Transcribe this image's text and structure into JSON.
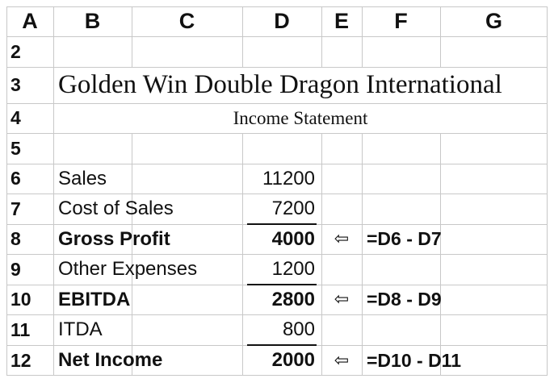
{
  "columns": [
    "A",
    "B",
    "C",
    "D",
    "E",
    "F",
    "G"
  ],
  "rows": [
    "2",
    "3",
    "4",
    "5",
    "6",
    "7",
    "8",
    "9",
    "10",
    "11",
    "12"
  ],
  "title": "Golden Win Double Dragon International",
  "subtitle": "Income Statement",
  "lines": [
    {
      "row": "6",
      "label": "Sales",
      "value": "11200",
      "bold": false,
      "arrow": "",
      "formula": ""
    },
    {
      "row": "7",
      "label": "Cost of Sales",
      "value": "7200",
      "bold": false,
      "arrow": "",
      "formula": ""
    },
    {
      "row": "8",
      "label": "Gross Profit",
      "value": "4000",
      "bold": true,
      "arrow": "⇦",
      "formula": "=D6 - D7"
    },
    {
      "row": "9",
      "label": "Other Expenses",
      "value": "1200",
      "bold": false,
      "arrow": "",
      "formula": ""
    },
    {
      "row": "10",
      "label": "EBITDA",
      "value": "2800",
      "bold": true,
      "arrow": "⇦",
      "formula": "=D8 - D9"
    },
    {
      "row": "11",
      "label": "ITDA",
      "value": "800",
      "bold": false,
      "arrow": "",
      "formula": ""
    },
    {
      "row": "12",
      "label": "Net Income",
      "value": "2000",
      "bold": true,
      "arrow": "⇦",
      "formula": "=D10 - D11"
    }
  ],
  "colors": {
    "gridline": "#c8c8c8",
    "text": "#111111",
    "background": "#ffffff"
  }
}
